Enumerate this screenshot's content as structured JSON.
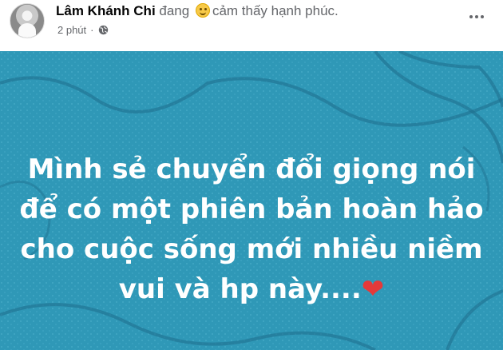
{
  "post": {
    "author": "Lâm Khánh Chi",
    "feeling_prefix": " đang ",
    "feeling_text": "cảm thấy hạnh phúc.",
    "time": "2 phút",
    "separator": "·",
    "privacy_icon": "globe-icon",
    "feeling_icon": "smile-emoji-icon",
    "more_icon": "more-options-icon",
    "body_lines": [
      "Mình sẻ chuyển đổi giọng nói",
      "để có một phiên bản hoàn hảo",
      "cho cuộc sống mới nhiều niềm",
      "vui và hp này...."
    ],
    "heart_emoji": "❤",
    "background_color": "#2f98b7",
    "text_color": "#ffffff"
  }
}
